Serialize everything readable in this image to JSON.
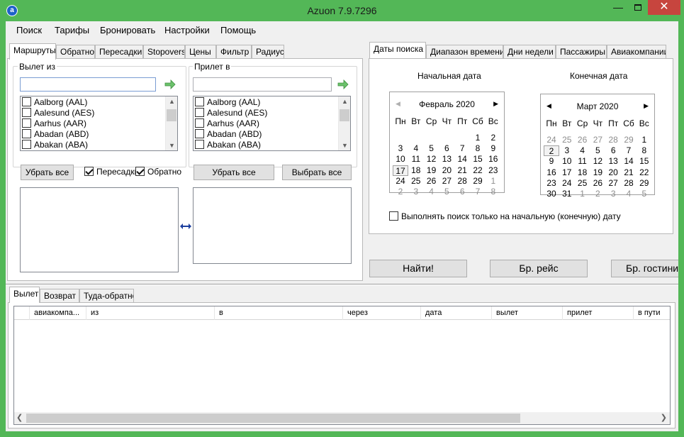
{
  "window": {
    "title": "Azuon 7.9.7296",
    "icon": "azuon-logo-icon",
    "controls": {
      "minimize": "—",
      "close": "✕"
    }
  },
  "menu": [
    "Поиск",
    "Тарифы",
    "Бронировать",
    "Настройки",
    "Помощь"
  ],
  "route_tabs": [
    "Маршруты",
    "Обратно",
    "Пересадки",
    "Stopovers",
    "Цены",
    "Фильтр",
    "Радиус"
  ],
  "departure": {
    "label": "Вылет из",
    "value": "",
    "airports": [
      "Aalborg (AAL)",
      "Aalesund (AES)",
      "Aarhus (AAR)",
      "Abadan (ABD)",
      "Abakan (ABA)"
    ],
    "remove_all": "Убрать все"
  },
  "arrival": {
    "label": "Прилет в",
    "value": "",
    "airports": [
      "Aalborg (AAL)",
      "Aalesund (AES)",
      "Aarhus (AAR)",
      "Abadan (ABD)",
      "Abakan (ABA)"
    ],
    "remove_all": "Убрать все",
    "select_all": "Выбрать все"
  },
  "options": {
    "transfers": {
      "label": "Пересадки",
      "checked": true
    },
    "return": {
      "label": "Обратно",
      "checked": true
    }
  },
  "swap_icon": "swap-arrows-icon",
  "date_tabs": [
    "Даты поиска",
    "Диапазон времени",
    "Дни недели",
    "Пассажиры",
    "Авиакомпании"
  ],
  "start_date": {
    "label": "Начальная дата",
    "month": "Февраль 2020",
    "weekdays": [
      "Пн",
      "Вт",
      "Ср",
      "Чт",
      "Пт",
      "Сб",
      "Вс"
    ],
    "weeks": [
      [
        "",
        "",
        "",
        "",
        "",
        "1",
        "2"
      ],
      [
        "3",
        "4",
        "5",
        "6",
        "7",
        "8",
        "9"
      ],
      [
        "10",
        "11",
        "12",
        "13",
        "14",
        "15",
        "16"
      ],
      [
        "17",
        "18",
        "19",
        "20",
        "21",
        "22",
        "23"
      ],
      [
        "24",
        "25",
        "26",
        "27",
        "28",
        "29",
        "1"
      ],
      [
        "2",
        "3",
        "4",
        "5",
        "6",
        "7",
        "8"
      ]
    ],
    "dim_cells": [
      [
        4,
        6
      ],
      [
        5,
        0
      ],
      [
        5,
        1
      ],
      [
        5,
        2
      ],
      [
        5,
        3
      ],
      [
        5,
        4
      ],
      [
        5,
        5
      ],
      [
        5,
        6
      ]
    ],
    "selected": [
      3,
      0
    ]
  },
  "end_date": {
    "label": "Конечная дата",
    "month": "Март 2020",
    "weekdays": [
      "Пн",
      "Вт",
      "Ср",
      "Чт",
      "Пт",
      "Сб",
      "Вс"
    ],
    "weeks": [
      [
        "24",
        "25",
        "26",
        "27",
        "28",
        "29",
        "1"
      ],
      [
        "2",
        "3",
        "4",
        "5",
        "6",
        "7",
        "8"
      ],
      [
        "9",
        "10",
        "11",
        "12",
        "13",
        "14",
        "15"
      ],
      [
        "16",
        "17",
        "18",
        "19",
        "20",
        "21",
        "22"
      ],
      [
        "23",
        "24",
        "25",
        "26",
        "27",
        "28",
        "29"
      ],
      [
        "30",
        "31",
        "1",
        "2",
        "3",
        "4",
        "5"
      ]
    ],
    "dim_cells": [
      [
        0,
        0
      ],
      [
        0,
        1
      ],
      [
        0,
        2
      ],
      [
        0,
        3
      ],
      [
        0,
        4
      ],
      [
        0,
        5
      ],
      [
        6,
        0
      ],
      [
        5,
        2
      ],
      [
        5,
        3
      ],
      [
        5,
        4
      ],
      [
        5,
        5
      ],
      [
        5,
        6
      ]
    ],
    "selected": [
      1,
      0
    ]
  },
  "only_start_date": {
    "label": "Выполнять поиск только на начальную (конечную) дату",
    "checked": false
  },
  "actions": {
    "find": "Найти!",
    "book_flight": "Бр. рейс",
    "book_hotel": "Бр. гостини"
  },
  "result_tabs": [
    "Вылет",
    "Возврат",
    "Туда-обратно"
  ],
  "columns": [
    "авиакомпа...",
    "из",
    "в",
    "через",
    "дата",
    "вылет",
    "прилет",
    "в пути"
  ],
  "colors": {
    "titlebar": "#53b757",
    "close": "#c7453e",
    "arrow": "#5cb85c",
    "swap": "#1c3f9e"
  }
}
